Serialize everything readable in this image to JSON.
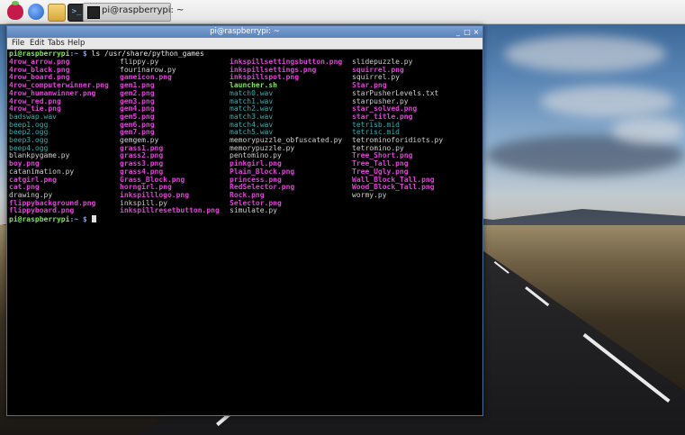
{
  "taskbar": {
    "task_label": "pi@raspberrypi: ~"
  },
  "window": {
    "title": "pi@raspberrypi: ~",
    "controls": [
      "_",
      "□",
      "×"
    ],
    "menu": [
      "File",
      "Edit",
      "Tabs",
      "Help"
    ]
  },
  "terminal": {
    "prompt_user": "pi@raspberrypi",
    "prompt_path": ":~ $",
    "command": "ls /usr/share/python_games",
    "columns": [
      [
        {
          "t": "4row_arrow.png",
          "k": "img"
        },
        {
          "t": "4row_black.png",
          "k": "img"
        },
        {
          "t": "4row_board.png",
          "k": "img"
        },
        {
          "t": "4row_computerwinner.png",
          "k": "img"
        },
        {
          "t": "4row_humanwinner.png",
          "k": "img"
        },
        {
          "t": "4row_red.png",
          "k": "img"
        },
        {
          "t": "4row_tie.png",
          "k": "img"
        },
        {
          "t": "badswap.wav",
          "k": "snd"
        },
        {
          "t": "beep1.ogg",
          "k": "snd"
        },
        {
          "t": "beep2.ogg",
          "k": "snd"
        },
        {
          "t": "beep3.ogg",
          "k": "snd"
        },
        {
          "t": "beep4.ogg",
          "k": "snd"
        },
        {
          "t": "blankpygame.py",
          "k": "py"
        },
        {
          "t": "boy.png",
          "k": "img"
        },
        {
          "t": "catanimation.py",
          "k": "py"
        },
        {
          "t": "catgirl.png",
          "k": "img"
        },
        {
          "t": "cat.png",
          "k": "img"
        },
        {
          "t": "drawing.py",
          "k": "py"
        },
        {
          "t": "flippybackground.png",
          "k": "img"
        },
        {
          "t": "flippyboard.png",
          "k": "img"
        }
      ],
      [
        {
          "t": "flippy.py",
          "k": "py"
        },
        {
          "t": "fourinarow.py",
          "k": "py"
        },
        {
          "t": "gameicon.png",
          "k": "img"
        },
        {
          "t": "gem1.png",
          "k": "img"
        },
        {
          "t": "gem2.png",
          "k": "img"
        },
        {
          "t": "gem3.png",
          "k": "img"
        },
        {
          "t": "gem4.png",
          "k": "img"
        },
        {
          "t": "gem5.png",
          "k": "img"
        },
        {
          "t": "gem6.png",
          "k": "img"
        },
        {
          "t": "gem7.png",
          "k": "img"
        },
        {
          "t": "gemgem.py",
          "k": "py"
        },
        {
          "t": "grass1.png",
          "k": "img"
        },
        {
          "t": "grass2.png",
          "k": "img"
        },
        {
          "t": "grass3.png",
          "k": "img"
        },
        {
          "t": "grass4.png",
          "k": "img"
        },
        {
          "t": "Grass_Block.png",
          "k": "img"
        },
        {
          "t": "horngirl.png",
          "k": "img"
        },
        {
          "t": "inkspilllogo.png",
          "k": "img"
        },
        {
          "t": "inkspill.py",
          "k": "py"
        },
        {
          "t": "inkspillresetbutton.png",
          "k": "img"
        }
      ],
      [
        {
          "t": "inkspillsettingsbutton.png",
          "k": "img"
        },
        {
          "t": "inkspillsettings.png",
          "k": "img"
        },
        {
          "t": "inkspillspot.png",
          "k": "img"
        },
        {
          "t": "launcher.sh",
          "k": "exe"
        },
        {
          "t": "match0.wav",
          "k": "snd"
        },
        {
          "t": "match1.wav",
          "k": "snd"
        },
        {
          "t": "match2.wav",
          "k": "snd"
        },
        {
          "t": "match3.wav",
          "k": "snd"
        },
        {
          "t": "match4.wav",
          "k": "snd"
        },
        {
          "t": "match5.wav",
          "k": "snd"
        },
        {
          "t": "memorypuzzle_obfuscated.py",
          "k": "py"
        },
        {
          "t": "memorypuzzle.py",
          "k": "py"
        },
        {
          "t": "pentomino.py",
          "k": "py"
        },
        {
          "t": "pinkgirl.png",
          "k": "img"
        },
        {
          "t": "Plain_Block.png",
          "k": "img"
        },
        {
          "t": "princess.png",
          "k": "img"
        },
        {
          "t": "RedSelector.png",
          "k": "img"
        },
        {
          "t": "Rock.png",
          "k": "img"
        },
        {
          "t": "Selector.png",
          "k": "img"
        },
        {
          "t": "simulate.py",
          "k": "py"
        }
      ],
      [
        {
          "t": "slidepuzzle.py",
          "k": "py"
        },
        {
          "t": "squirrel.png",
          "k": "img"
        },
        {
          "t": "squirrel.py",
          "k": "py"
        },
        {
          "t": "Star.png",
          "k": "img"
        },
        {
          "t": "starPusherLevels.txt",
          "k": "py"
        },
        {
          "t": "starpusher.py",
          "k": "py"
        },
        {
          "t": "star_solved.png",
          "k": "img"
        },
        {
          "t": "star_title.png",
          "k": "img"
        },
        {
          "t": "tetrisb.mid",
          "k": "snd"
        },
        {
          "t": "tetrisc.mid",
          "k": "snd"
        },
        {
          "t": "tetrominoforidiots.py",
          "k": "py"
        },
        {
          "t": "tetromino.py",
          "k": "py"
        },
        {
          "t": "Tree_Short.png",
          "k": "img"
        },
        {
          "t": "Tree_Tall.png",
          "k": "img"
        },
        {
          "t": "Tree_Ugly.png",
          "k": "img"
        },
        {
          "t": "Wall_Block_Tall.png",
          "k": "img"
        },
        {
          "t": "Wood_Block_Tall.png",
          "k": "img"
        },
        {
          "t": "wormy.py",
          "k": "py"
        }
      ]
    ]
  }
}
